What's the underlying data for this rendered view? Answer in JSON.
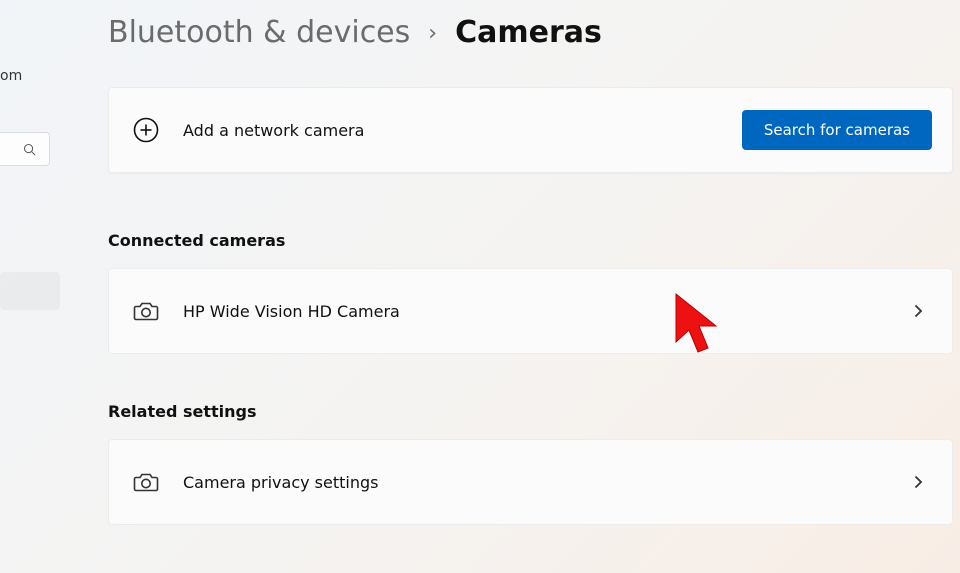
{
  "sidebar": {
    "user_fragment": "om"
  },
  "breadcrumb": {
    "parent": "Bluetooth & devices",
    "current": "Cameras"
  },
  "add_camera": {
    "label": "Add a network camera",
    "button": "Search for cameras"
  },
  "sections": {
    "connected_heading": "Connected cameras",
    "connected_items": [
      {
        "label": "HP Wide Vision HD Camera"
      }
    ],
    "related_heading": "Related settings",
    "related_items": [
      {
        "label": "Camera privacy settings"
      }
    ]
  }
}
